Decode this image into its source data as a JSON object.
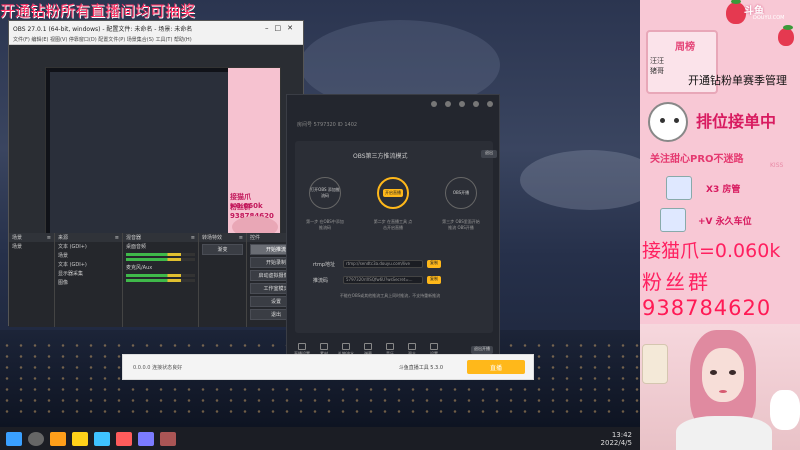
{
  "banner": {
    "text": "开通钻粉所有直播间均可抽奖"
  },
  "obs": {
    "title": "OBS 27.0.1 (64-bit, windows) - 配置文件: 未命名 - 场景: 未命名",
    "menu": "文件(F)  编辑(E)  视图(V)  停靠窗口(D)  配置文件(P)  场景集合(S)  工具(T)  帮助(H)",
    "docks": {
      "scenes": {
        "header": "场景",
        "items": [
          "场景"
        ]
      },
      "sources": {
        "header": "来源",
        "items": [
          "文本 (GDI+)",
          "场景",
          "文本 (GDI+)",
          "显示器采集",
          "图像"
        ]
      },
      "mixer": {
        "header": "混音器",
        "items": [
          "桌面音频",
          "麦克风/Aux"
        ]
      },
      "transitions": {
        "header": "转场特效",
        "items": [
          "渐变"
        ]
      },
      "controls": {
        "header": "控件",
        "buttons": [
          "开始推流",
          "开始录制",
          "启动虚拟摄像机",
          "工作室模式",
          "设置",
          "退出"
        ]
      }
    },
    "preview": {
      "rank_text": "接猫爪=0.060k",
      "group_text": "粉丝群",
      "qq": "938784620"
    }
  },
  "tool": {
    "room_line": "房间号 5797320   ID 1402",
    "mode_title": "OBS第三方推流模式",
    "exit_label": "退出",
    "steps": [
      {
        "circle": "打开OBS\n添加推流码",
        "label": "第一步 在OBS中添加推流码"
      },
      {
        "circle": "开启直播",
        "label": "第二步 在直播工具\n点击开启直播"
      },
      {
        "circle": "OBS开播",
        "label": "第三步 OBS里面开始推流\nOBS开播"
      }
    ],
    "fields": [
      {
        "label": "rtmp地址",
        "value": "rtmp://sendtc3a.douyu.com/live",
        "copy": "复制"
      },
      {
        "label": "推流码",
        "value": "5797320rlXSQfw6U?wsSecret=...",
        "copy": "复制"
      }
    ],
    "note": "不能在OBS或其他推流工具上同时推流，不支持重新推流",
    "bottom_items": [
      "直播设置",
      "素材",
      "礼物流水",
      "弹幕",
      "音乐",
      "观众",
      "设置"
    ],
    "start_label": "退出开播"
  },
  "tool2": {
    "address": "0.0.0.0 连接状态良好",
    "version": "斗鱼直播工具 5.3.0",
    "go": "直播"
  },
  "taskbar": {
    "time": "13:42",
    "date": "2022/4/5"
  },
  "side": {
    "logo": "斗鱼",
    "logo_sub": "DOUYU.COM",
    "rank_title": "周榜",
    "rank_line1": "汪汪",
    "rank_line2": "猪哥",
    "caption": "开通钻粉单赛季管理",
    "sign": "排位接单中",
    "follow": "关注甜心PRO不迷路",
    "kiss": "KISS",
    "reward1": "X3 房管",
    "reward2": "+V 永久车位",
    "price": "接猫爪=0.060k",
    "group": "粉丝群",
    "qq": "938784620"
  },
  "colors": {
    "accent": "#ffb81a",
    "pink": "#ff2060",
    "panel": "#f8c8d5"
  }
}
